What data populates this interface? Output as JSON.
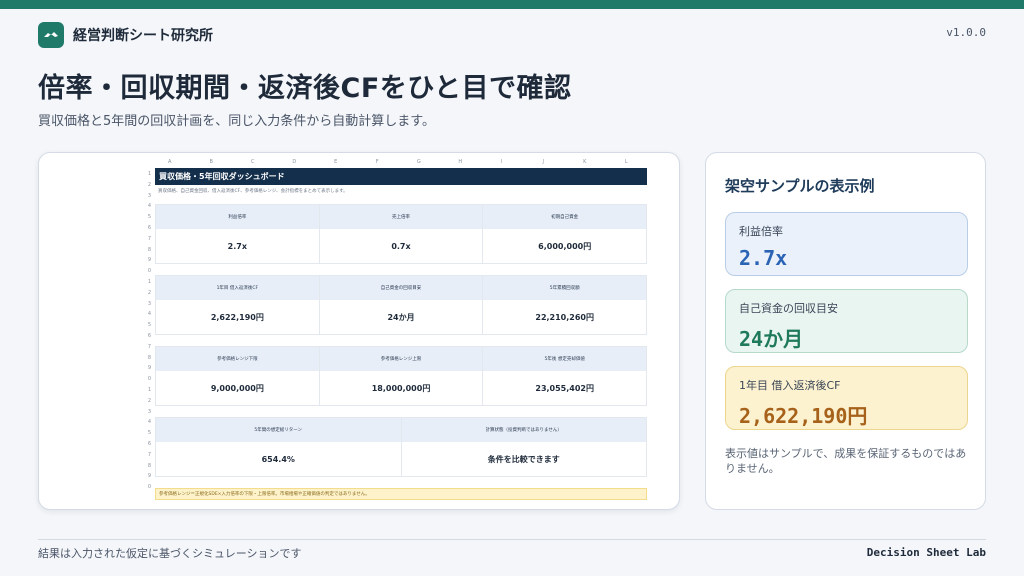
{
  "header": {
    "brand": "経営判断シート研究所",
    "version": "v1.0.0",
    "title": "倍率・回収期間・返済後CFをひと目で確認",
    "subtitle": "買収価格と5年間の回収計画を、同じ入力条件から自動計算します。"
  },
  "sheet": {
    "columns": [
      "A",
      "B",
      "C",
      "D",
      "E",
      "F",
      "G",
      "H",
      "I",
      "J",
      "K",
      "L"
    ],
    "rows": [
      "1",
      "2",
      "3",
      "4",
      "5",
      "6",
      "7",
      "8",
      "9",
      "0",
      "1",
      "2",
      "3",
      "4",
      "5",
      "6",
      "7",
      "8",
      "9",
      "0",
      "1",
      "2",
      "3",
      "4",
      "5",
      "6",
      "7",
      "8",
      "9",
      "0"
    ],
    "dashboard_title": "買収価格・5年回収ダッシュボード",
    "dashboard_desc": "買収価格、自己資金回収、借入返済後CF、参考価格レンジ、会計指標をまとめて表示します。",
    "blocks": [
      {
        "cells": [
          {
            "label": "利益倍率",
            "value": "2.7x"
          },
          {
            "label": "売上倍率",
            "value": "0.7x"
          },
          {
            "label": "初期自己資金",
            "value": "6,000,000円"
          }
        ]
      },
      {
        "cells": [
          {
            "label": "1年目 借入返済後CF",
            "value": "2,622,190円"
          },
          {
            "label": "自己資金の回収目安",
            "value": "24か月"
          },
          {
            "label": "5年累積回収額",
            "value": "22,210,260円"
          }
        ]
      },
      {
        "cells": [
          {
            "label": "参考価格レンジ下限",
            "value": "9,000,000円"
          },
          {
            "label": "参考価格レンジ上限",
            "value": "18,000,000円"
          },
          {
            "label": "5年後 想定売却価値",
            "value": "23,055,402円"
          }
        ]
      },
      {
        "cells": [
          {
            "label": "5年間の想定総リターン",
            "value": "654.4%"
          },
          {
            "label": "計算状態（投資判断ではありません）",
            "value": "条件を比較できます"
          }
        ]
      }
    ],
    "note": "参考価格レンジ＝正規化SDE×入力倍率の下限・上限倍率。市場相場や正確価値の判定ではありません。"
  },
  "sample": {
    "title": "架空サンプルの表示例",
    "metrics": [
      {
        "label": "利益倍率",
        "value": "2.7x"
      },
      {
        "label": "自己資金の回収目安",
        "value": "24か月"
      },
      {
        "label": "1年目 借入返済後CF",
        "value": "2,622,190円"
      }
    ],
    "disclaimer": "表示値はサンプルで、成果を保証するものではありません。"
  },
  "footer": {
    "left": "結果は入力された仮定に基づくシミュレーションです",
    "right": "Decision Sheet Lab"
  },
  "colors": {
    "brand": "#1f7a6a",
    "navy": "#142f4c",
    "blue_metric": "#2b64b5",
    "green_metric": "#1f7a5c",
    "amber_metric": "#a6621b"
  },
  "icons": {
    "logo": "handshake-icon"
  }
}
